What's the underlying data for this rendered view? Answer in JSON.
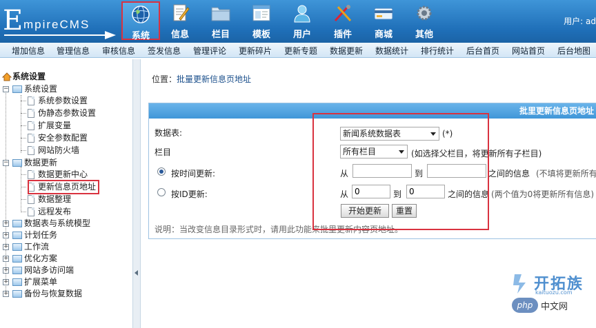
{
  "header": {
    "logo_text": "EmpireCMS",
    "nav": [
      {
        "label": "系统",
        "icon": "globe-icon",
        "active": true
      },
      {
        "label": "信息",
        "icon": "document-edit-icon"
      },
      {
        "label": "栏目",
        "icon": "folder-icon"
      },
      {
        "label": "模板",
        "icon": "window-template-icon"
      },
      {
        "label": "用户",
        "icon": "user-icon"
      },
      {
        "label": "插件",
        "icon": "tools-icon"
      },
      {
        "label": "商城",
        "icon": "card-icon"
      },
      {
        "label": "其他",
        "icon": "gear-icon"
      }
    ],
    "user_label": "用户: ad"
  },
  "menubar": [
    "增加信息",
    "管理信息",
    "审核信息",
    "签发信息",
    "管理评论",
    "更新碎片",
    "更新专题",
    "数据更新",
    "数据统计",
    "排行统计",
    "后台首页",
    "网站首页",
    "后台地图"
  ],
  "sidebar": {
    "root": "系统设置",
    "items": [
      "系统设置",
      "系统参数设置",
      "伪静态参数设置",
      "扩展变量",
      "安全参数配置",
      "网站防火墙",
      "数据更新",
      "数据更新中心",
      "更新信息页地址",
      "数据整理",
      "远程发布",
      "数据表与系统模型",
      "计划任务",
      "工作流",
      "优化方案",
      "网站多访问端",
      "扩展菜单",
      "备份与恢复数据"
    ]
  },
  "main": {
    "location_label": "位置：",
    "location_link": "批量更新信息页地址",
    "panel_title": "批里更新信息页地址",
    "table_label": "数据表:",
    "table_value": "新闻系统数据表",
    "table_required": "(*)",
    "column_label": "栏目",
    "column_value": "所有栏目",
    "column_hint": "(如选择父栏目，将更新所有子栏目)",
    "by_time_label": "按时间更新:",
    "from": "从",
    "to": "到",
    "time_suffix": "之间的信息",
    "time_hint": "(不填将更新所有",
    "by_id_label": "按ID更新:",
    "id_from_value": "0",
    "id_to_value": "0",
    "id_suffix": "之间的信息",
    "id_hint": "(两个值为0将更新所有信息)",
    "start_button": "开始更新",
    "reset_button": "重置",
    "note": "说明：当改变信息目录形式时，请用此功能来批里更新内容页地址。"
  },
  "watermark": {
    "brand1": "开拓族",
    "brand1_sub": "kaituozu.com",
    "brand2": "中文网",
    "brand2_prefix": "php"
  },
  "colors": {
    "header_blue": "#2a7ec6",
    "highlight_red": "#d9323f",
    "panel_head": "#4a9ede"
  }
}
